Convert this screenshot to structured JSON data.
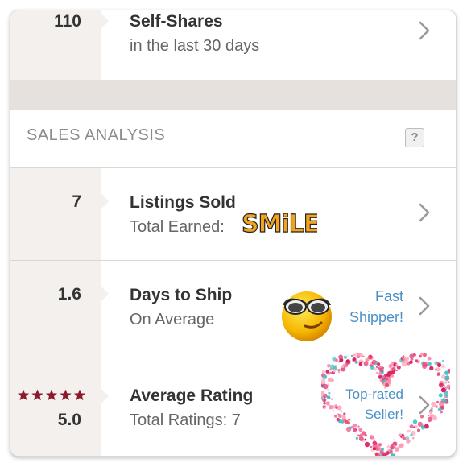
{
  "rows": {
    "self_shares": {
      "value": "110",
      "title": "Self-Shares",
      "subtitle": "in the last 30 days"
    },
    "listings_sold": {
      "value": "7",
      "title": "Listings Sold",
      "subtitle": "Total Earned:",
      "sticker_text": "SMiLE"
    },
    "days_to_ship": {
      "value": "1.6",
      "title": "Days to Ship",
      "subtitle": "On Average",
      "badge_line1": "Fast",
      "badge_line2": "Shipper!"
    },
    "average_rating": {
      "value": "5.0",
      "stars": 5,
      "title": "Average Rating",
      "subtitle": "Total Ratings: 7",
      "badge_line1": "Top-rated",
      "badge_line2": "Seller!"
    }
  },
  "section": {
    "title": "SALES ANALYSIS",
    "help_label": "?"
  },
  "colors": {
    "star": "#8b1a2b",
    "badge_text": "#4a90c7",
    "left_column": "#f3f0ed",
    "divider_band": "#e6e1dc"
  },
  "icons": [
    "chevron-right-icon",
    "help-icon",
    "sunglasses-smiley-icon",
    "heart-frame-icon",
    "star-icon"
  ]
}
